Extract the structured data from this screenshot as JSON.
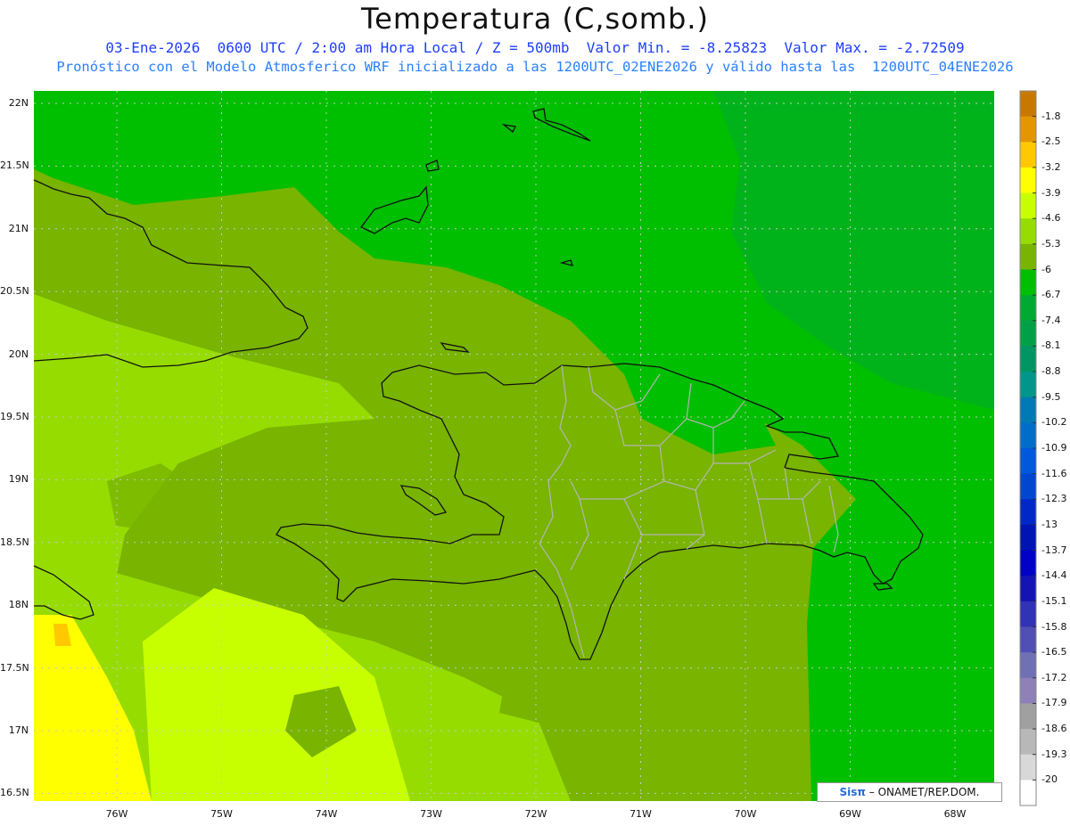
{
  "header": {
    "title": "Temperatura (C,somb.)",
    "line1": "03-Ene-2026  0600 UTC / 2:00 am Hora Local / Z = 500mb  Valor Min. = -8.25823  Valor Max. = -2.72509",
    "line2": "Pronóstico con el Modelo Atmosferico WRF inicializado a las 1200UTC_02ENE2026 y válido hasta las  1200UTC_04ENE2026"
  },
  "lat_labels": [
    "22N",
    "21.5N",
    "21N",
    "20.5N",
    "20N",
    "19.5N",
    "19N",
    "18.5N",
    "18N",
    "17.5N",
    "17N",
    "16.5N"
  ],
  "lon_labels": [
    "76W",
    "75W",
    "74W",
    "73W",
    "72W",
    "71W",
    "70W",
    "69W",
    "68W"
  ],
  "colorbar": {
    "labels": [
      "-1.8",
      "-2.5",
      "-3.2",
      "-3.9",
      "-4.6",
      "-5.3",
      "-6",
      "-6.7",
      "-7.4",
      "-8.1",
      "-8.8",
      "-9.5",
      "-10.2",
      "-10.9",
      "-11.6",
      "-12.3",
      "-13",
      "-13.7",
      "-14.4",
      "-15.1",
      "-15.8",
      "-16.5",
      "-17.2",
      "-17.9",
      "-18.6",
      "-19.3",
      "-20"
    ],
    "colors": [
      "#c77800",
      "#e39600",
      "#ffc800",
      "#ffff00",
      "#c8ff00",
      "#96dc00",
      "#78b400",
      "#00be00",
      "#00aa32",
      "#00a046",
      "#009664",
      "#00968c",
      "#007ab4",
      "#006ec8",
      "#0058dc",
      "#0046d0",
      "#0028c8",
      "#0014b4",
      "#0000c8",
      "#1414b4",
      "#3232b4",
      "#5050b4",
      "#7070b4",
      "#9080b8",
      "#a0a0a0",
      "#b8b8b8",
      "#d8d8d8",
      "#ffffff"
    ]
  },
  "credit": {
    "brand": "Sisπ",
    "text": "– ONAMET/REP.DOM."
  }
}
